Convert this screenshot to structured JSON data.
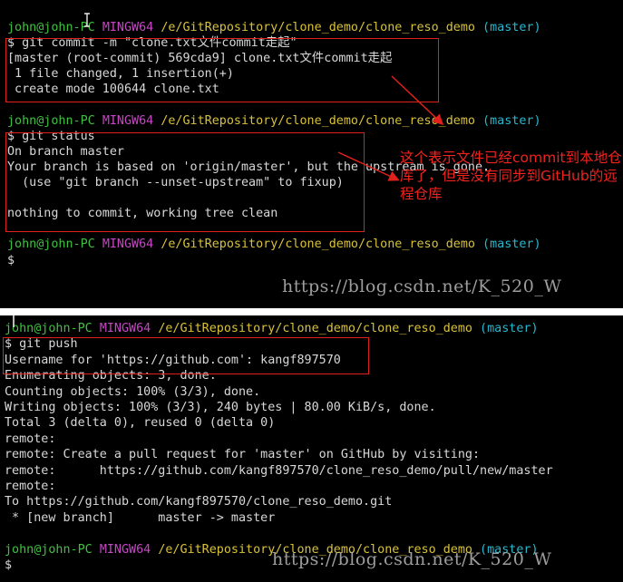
{
  "terminal1": {
    "lines": [
      {
        "user": "john@john-PC",
        "mingw": "MINGW64",
        "path": "/e/GitRepository/clone_demo/clone_reso_demo",
        "branch": "(master)"
      },
      {
        "text": "$ git commit -m \"clone.txt文件commit走起\""
      },
      {
        "text": "[master (root-commit) 569cda9] clone.txt文件commit走起"
      },
      {
        "text": " 1 file changed, 1 insertion(+)"
      },
      {
        "text": " create mode 100644 clone.txt"
      },
      {
        "text": ""
      },
      {
        "user": "john@john-PC",
        "mingw": "MINGW64",
        "path": "/e/GitRepository/clone_demo/clone_reso_demo",
        "branch": "(master)"
      },
      {
        "text": "$ git status"
      },
      {
        "text": "On branch master"
      },
      {
        "text": "Your branch is based on 'origin/master', but the upstream is gone."
      },
      {
        "text": "  (use \"git branch --unset-upstream\" to fixup)"
      },
      {
        "text": ""
      },
      {
        "text": "nothing to commit, working tree clean"
      },
      {
        "text": ""
      },
      {
        "user": "john@john-PC",
        "mingw": "MINGW64",
        "path": "/e/GitRepository/clone_demo/clone_reso_demo",
        "branch": "(master)"
      },
      {
        "text": "$"
      }
    ],
    "annotation": "这个表示文件已经commit到本地仓库了，但是没有同步到GitHub的远程仓库",
    "watermark": "https://blog.csdn.net/K_520_W"
  },
  "terminal2": {
    "lines": [
      {
        "user": "john@john-PC",
        "mingw": "MINGW64",
        "path": "/e/GitRepository/clone_demo/clone_reso_demo",
        "branch": "(master)"
      },
      {
        "text": "$ git push"
      },
      {
        "text": "Username for 'https://github.com': kangf897570"
      },
      {
        "text": "Enumerating objects: 3, done."
      },
      {
        "text": "Counting objects: 100% (3/3), done."
      },
      {
        "text": "Writing objects: 100% (3/3), 240 bytes | 80.00 KiB/s, done."
      },
      {
        "text": "Total 3 (delta 0), reused 0 (delta 0)"
      },
      {
        "text": "remote:"
      },
      {
        "text": "remote: Create a pull request for 'master' on GitHub by visiting:"
      },
      {
        "text": "remote:      https://github.com/kangf897570/clone_reso_demo/pull/new/master"
      },
      {
        "text": "remote:"
      },
      {
        "text": "To https://github.com/kangf897570/clone_reso_demo.git"
      },
      {
        "text": " * [new branch]      master -> master"
      },
      {
        "text": ""
      },
      {
        "user": "john@john-PC",
        "mingw": "MINGW64",
        "path": "/e/GitRepository/clone_demo/clone_reso_demo",
        "branch": "(master)"
      },
      {
        "text": "$"
      }
    ],
    "watermark": "https://blog.csdn.net/K_520_W"
  },
  "colors": {
    "background": "#000000",
    "text": "#d8d8d8",
    "user": "#3ec23e",
    "mingw": "#c547c5",
    "path": "#d8c23a",
    "branch": "#28b8d0",
    "highlight": "#e0201a"
  }
}
